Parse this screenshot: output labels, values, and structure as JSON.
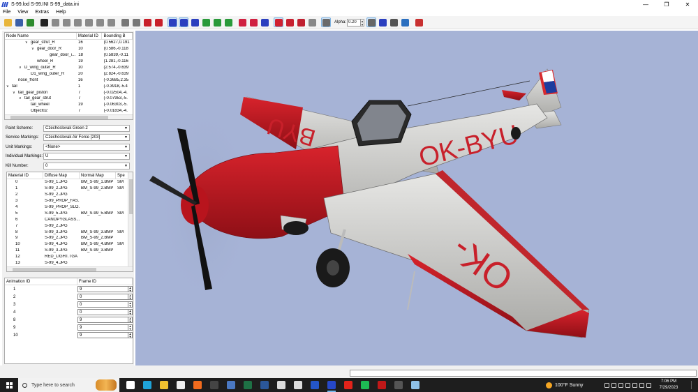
{
  "window": {
    "title": "S-99.lod  S-99.INI  S-99_data.ini"
  },
  "menu": [
    "File",
    "View",
    "Extras",
    "Help"
  ],
  "toolbar": {
    "alpha_label": "Alpha:",
    "alpha_value": "0.20",
    "buttons": [
      {
        "icon": "folder-open-icon",
        "color": "#e8b53a"
      },
      {
        "icon": "save-icon",
        "color": "#3a5fa8"
      },
      {
        "icon": "texture-icon",
        "color": "#2e8b2e"
      },
      {
        "icon": "sep"
      },
      {
        "icon": "zoom-icon",
        "color": "#222222"
      },
      {
        "icon": "box-front-icon",
        "color": "#8a8a8a"
      },
      {
        "icon": "box-side-icon",
        "color": "#8a8a8a"
      },
      {
        "icon": "box-top-icon",
        "color": "#8a8a8a"
      },
      {
        "icon": "box-back-icon",
        "color": "#8a8a8a"
      },
      {
        "icon": "box-bottom-icon",
        "color": "#8a8a8a"
      },
      {
        "icon": "box-iso-icon",
        "color": "#8a8a8a"
      },
      {
        "icon": "sep"
      },
      {
        "icon": "solid-icon",
        "color": "#777777"
      },
      {
        "icon": "solid-shaded-icon",
        "color": "#777777"
      },
      {
        "icon": "red-solid-icon",
        "color": "#c8202a"
      },
      {
        "icon": "red-cube-icon",
        "color": "#c8202a"
      },
      {
        "icon": "sep"
      },
      {
        "icon": "blue-frame-icon",
        "color": "#2b3fbf",
        "selected": true
      },
      {
        "icon": "blue-frame-2-icon",
        "color": "#2b3fbf",
        "selected": true
      },
      {
        "icon": "blue-frame-3-icon",
        "color": "#2b3fbf"
      },
      {
        "icon": "green-frame-icon",
        "color": "#2a9a3a"
      },
      {
        "icon": "green-frame-2-icon",
        "color": "#2a9a3a"
      },
      {
        "icon": "green-frame-3-icon",
        "color": "#2a9a3a"
      },
      {
        "icon": "sep"
      },
      {
        "icon": "red-shape-icon",
        "color": "#d02040"
      },
      {
        "icon": "red-shape-2-icon",
        "color": "#d02040"
      },
      {
        "icon": "red-blue-icon",
        "color": "#2b3fbf"
      },
      {
        "icon": "sep"
      },
      {
        "icon": "red-circle-icon",
        "color": "#d02030",
        "selected": true
      },
      {
        "icon": "red-drop-icon",
        "color": "#c82030"
      },
      {
        "icon": "red-mesh-icon",
        "color": "#c02030"
      },
      {
        "icon": "grey-mesh-icon",
        "color": "#888888"
      },
      {
        "icon": "sep"
      },
      {
        "icon": "grey-box-icon",
        "color": "#6a6a6a",
        "selected": true
      },
      {
        "icon": "alpha-field"
      },
      {
        "icon": "grid-icon",
        "color": "#666666",
        "selected": true
      },
      {
        "icon": "axes-icon",
        "color": "#2b3fbf"
      },
      {
        "icon": "bounding-icon",
        "color": "#555555"
      },
      {
        "icon": "cube-outline-icon",
        "color": "#2b6fbf"
      },
      {
        "icon": "sep"
      },
      {
        "icon": "tools-icon",
        "color": "#c83030"
      }
    ]
  },
  "tree": {
    "headers": [
      "Node Name",
      "Material ID",
      "Bounding B"
    ],
    "rows": [
      {
        "indent": 3,
        "toggle": "v",
        "name": "gear_strut_R",
        "mat": "16",
        "bb": "(0.5627,0.191"
      },
      {
        "indent": 4,
        "toggle": "v",
        "name": "gear_door_R",
        "mat": "10",
        "bb": "(0.586,-0.118"
      },
      {
        "indent": 6,
        "toggle": "",
        "name": "gear_door_i...",
        "mat": "18",
        "bb": "(0.5839,-0.11"
      },
      {
        "indent": 4,
        "toggle": "",
        "name": "wheel_R",
        "mat": "19",
        "bb": "(1.281,-0.116"
      },
      {
        "indent": 2,
        "toggle": "v",
        "name": "D_wing_outer_R",
        "mat": "10",
        "bb": "(2.574,-0.639"
      },
      {
        "indent": 3,
        "toggle": "",
        "name": "D1_wing_outer_R",
        "mat": "20",
        "bb": "(2.824,-0.639"
      },
      {
        "indent": 1,
        "toggle": "",
        "name": "nose_front",
        "mat": "16",
        "bb": "(-0.3685,2.35"
      },
      {
        "indent": 0,
        "toggle": "v",
        "name": "tail",
        "mat": "1",
        "bb": "(-0.3918,-5.4"
      },
      {
        "indent": 1,
        "toggle": "v",
        "name": "tail_gear_piston",
        "mat": "7",
        "bb": "(-0.02504,-4."
      },
      {
        "indent": 2,
        "toggle": "v",
        "name": "tail_gear_strut",
        "mat": "7",
        "bb": "(-0.07953,-5."
      },
      {
        "indent": 3,
        "toggle": "",
        "name": "tail_wheel",
        "mat": "19",
        "bb": "(-0.06303,-5."
      },
      {
        "indent": 3,
        "toggle": "",
        "name": "Object02",
        "mat": "7",
        "bb": "(-0.01834,-4."
      }
    ]
  },
  "props": [
    {
      "label": "Paint Scheme:",
      "value": "Czechoslovak Green 2"
    },
    {
      "label": "Service Markings:",
      "value": "Czechoslovak Air Force [203]"
    },
    {
      "label": "Unit Markings:",
      "value": "<None>"
    },
    {
      "label": "Individual Markings:",
      "value": "U"
    },
    {
      "label": "Kill Number:",
      "value": "0"
    }
  ],
  "materials": {
    "headers": [
      "Material ID",
      "Diffuse Map",
      "Normal Map",
      "Spe"
    ],
    "rows": [
      [
        "0",
        "S-99_1.JPG",
        "BM_S-99_1.BMP",
        "SM"
      ],
      [
        "1",
        "S-99_2.JPG",
        "BM_S-99_2.BMP",
        "SM"
      ],
      [
        "2",
        "S-99_2.JPG",
        "",
        ""
      ],
      [
        "3",
        "S-99_PROP_FAS...",
        "",
        ""
      ],
      [
        "4",
        "S-99_PROP_SLO...",
        "",
        ""
      ],
      [
        "5",
        "S-99_5.JPG",
        "BM_S-99_5.BMP",
        "SM"
      ],
      [
        "6",
        "CANOPYGLASS...",
        "",
        ""
      ],
      [
        "7",
        "S-99_2.JPG",
        "",
        ""
      ],
      [
        "8",
        "S-99_3.JPG",
        "BM_S-99_3.BMP",
        "SM"
      ],
      [
        "9",
        "S-99_2.JPG",
        "BM_S-99_2.BMP",
        ""
      ],
      [
        "10",
        "S-99_4.JPG",
        "BM_S-99_4.BMP",
        "SM"
      ],
      [
        "11",
        "S-99_3.JPG",
        "BM_S-99_3.BMP",
        ""
      ],
      [
        "12",
        "RED_LIGHT.TGA",
        "",
        ""
      ],
      [
        "13",
        "S-99_4.JPG",
        "",
        ""
      ]
    ]
  },
  "animations": {
    "headers": [
      "Animation ID",
      "Frame ID"
    ],
    "rows": [
      [
        "1",
        "9"
      ],
      [
        "2",
        "0"
      ],
      [
        "3",
        "0"
      ],
      [
        "4",
        "0"
      ],
      [
        "8",
        "9"
      ],
      [
        "9",
        "9"
      ],
      [
        "10",
        "9"
      ]
    ]
  },
  "viewport": {
    "background": "#a6b3d6",
    "fuselage_marking": "OK-BYU",
    "wing_marking_left": "BYU",
    "wing_marking_right": "OK-"
  },
  "taskbar": {
    "search_placeholder": "Type here to search",
    "apps": [
      {
        "icon": "task-view-icon",
        "color": "#ffffff"
      },
      {
        "icon": "edge-icon",
        "color": "#1fa3d8"
      },
      {
        "icon": "file-explorer-icon",
        "color": "#f2c230"
      },
      {
        "icon": "calculator-icon",
        "color": "#f0f0f0"
      },
      {
        "icon": "firefox-icon",
        "color": "#f26b1d"
      },
      {
        "icon": "n-app-icon",
        "color": "#444444"
      },
      {
        "icon": "mail-icon",
        "color": "#4a78c2"
      },
      {
        "icon": "excel-icon",
        "color": "#1e7145"
      },
      {
        "icon": "word-icon",
        "color": "#2b579a"
      },
      {
        "icon": "photos-icon",
        "color": "#dddddd"
      },
      {
        "icon": "calendar-icon",
        "color": "#dddddd"
      },
      {
        "icon": "blue-app-icon",
        "color": "#2456c9"
      },
      {
        "icon": "lod-viewer-icon",
        "color": "#2648c8",
        "active": true
      },
      {
        "icon": "acrobat-icon",
        "color": "#e2231a"
      },
      {
        "icon": "spotify-icon",
        "color": "#1db954"
      },
      {
        "icon": "mcafee-icon",
        "color": "#c01818"
      },
      {
        "icon": "game-icon",
        "color": "#555555"
      },
      {
        "icon": "notepad-icon",
        "color": "#8fc1e8"
      }
    ],
    "weather": "100°F  Sunny",
    "time": "7:06 PM",
    "date": "7/29/2023"
  }
}
